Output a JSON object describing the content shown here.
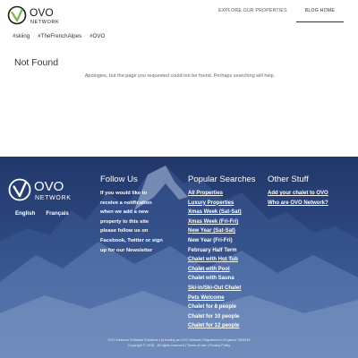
{
  "brand": {
    "logo_text": "OVO",
    "logo_subtext": "NETWORK",
    "primary_color": "#2c3e6b",
    "logo_accent": "#000000"
  },
  "nav": {
    "items": [
      {
        "label": "EXPLORE OUR PROPERTIES"
      },
      {
        "label": "BLOG HOME"
      }
    ]
  },
  "tags": [
    "#skiing",
    "#TheFrenchAlpes",
    "#OVO"
  ],
  "main": {
    "title": "Not Found",
    "message": "Apologies, but the page you requested could not be found. Perhaps searching will help."
  },
  "footer": {
    "languages": [
      "English",
      "Français"
    ],
    "follow": {
      "title": "Follow Us",
      "lines": [
        "If you would like to",
        "receive a notification",
        "when we add a new",
        "property to this site",
        "please follow us on",
        "Facebook, Twitter or sign",
        "up for our Newsletter"
      ]
    },
    "popular": {
      "title": "Popular Searches",
      "items": [
        "All Properties",
        "Luxury Properties",
        "Xmas Week (Sat-Sat)",
        "Xmas Week (Fri-Fri)",
        "New Year (Sat-Sat)",
        "New Year (Fri-Fri)",
        "February Half Term",
        "Chalet with Hot Tub",
        "Chalet with Pool",
        "Chalet with Sauna",
        "Ski-in/Ski-Out Chalet",
        "Pets Welcome",
        "Chalet for 8 people",
        "Chalet for 10 people",
        "Chalet for 12 people"
      ]
    },
    "other": {
      "title": "Other Stuff",
      "items": [
        "Add your chalet to OVO",
        "Who are OVO Network?"
      ]
    },
    "fine_print_1": "OVO Network Software Solutions Ltd trading as OVO Network Registered in England 7803348",
    "fine_print_2": "Copyright © 2016 - All rights reserved | Terms of use | Privacy Policy"
  }
}
